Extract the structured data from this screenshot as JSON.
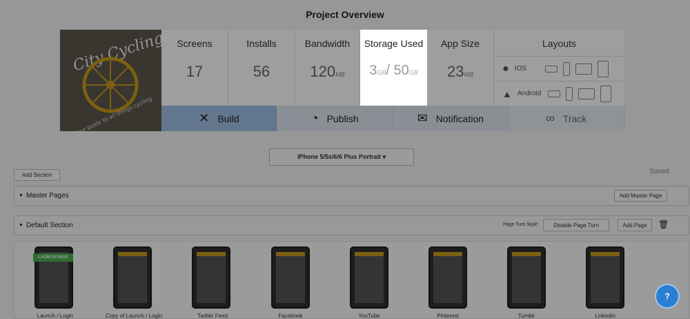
{
  "page": {
    "title": "Project Overview"
  },
  "logo": {
    "name": "City Cycling",
    "tagline": "your guide to all things cycling"
  },
  "stats": [
    {
      "label": "Screens",
      "value": "17",
      "unit": ""
    },
    {
      "label": "Installs",
      "value": "56",
      "unit": ""
    },
    {
      "label": "Bandwidth",
      "value": "120",
      "unit": "MB"
    },
    {
      "label": "Storage Used",
      "value": "3",
      "unit": "GB",
      "value2": "/ 50",
      "unit2": "GB"
    },
    {
      "label": "App Size",
      "value": "23",
      "unit": "MB"
    }
  ],
  "layouts": {
    "label": "Layouts",
    "ios": "IOS",
    "android": "Android"
  },
  "actions": {
    "build": "Build",
    "publish": "Publish",
    "notification": "Notification",
    "track": "Track"
  },
  "device_select": "IPhone 5/5s/6/6 Plus Portrait ▾",
  "toolbar": {
    "add_section": "Add Section",
    "saved": "Saved"
  },
  "master": {
    "title": "Master Pages",
    "add": "Add Master Page"
  },
  "default_section": {
    "title": "Default Section",
    "page_turn_label": "Page Turn Style:",
    "page_turn_value": "Disable Page Turn",
    "add_page": "Add Page"
  },
  "pages": [
    {
      "label": "Launch / Login",
      "badge": "LAUNCH PAGE"
    },
    {
      "label": "Copy of Launch / Login"
    },
    {
      "label": "Twitter Feed"
    },
    {
      "label": "Facebook"
    },
    {
      "label": "YouTube"
    },
    {
      "label": "Pinterest"
    },
    {
      "label": "Tumblr"
    },
    {
      "label": "Linkedin"
    }
  ],
  "help": "?"
}
